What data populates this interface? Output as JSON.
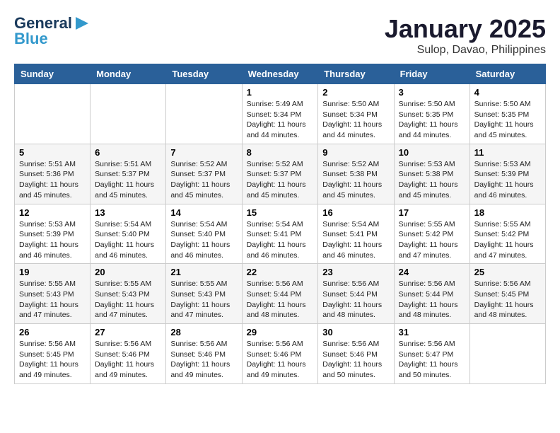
{
  "header": {
    "logo_general": "General",
    "logo_blue": "Blue",
    "month_title": "January 2025",
    "location": "Sulop, Davao, Philippines"
  },
  "weekdays": [
    "Sunday",
    "Monday",
    "Tuesday",
    "Wednesday",
    "Thursday",
    "Friday",
    "Saturday"
  ],
  "weeks": [
    [
      {
        "day": "",
        "sunrise": "",
        "sunset": "",
        "daylight": ""
      },
      {
        "day": "",
        "sunrise": "",
        "sunset": "",
        "daylight": ""
      },
      {
        "day": "",
        "sunrise": "",
        "sunset": "",
        "daylight": ""
      },
      {
        "day": "1",
        "sunrise": "Sunrise: 5:49 AM",
        "sunset": "Sunset: 5:34 PM",
        "daylight": "Daylight: 11 hours and 44 minutes."
      },
      {
        "day": "2",
        "sunrise": "Sunrise: 5:50 AM",
        "sunset": "Sunset: 5:34 PM",
        "daylight": "Daylight: 11 hours and 44 minutes."
      },
      {
        "day": "3",
        "sunrise": "Sunrise: 5:50 AM",
        "sunset": "Sunset: 5:35 PM",
        "daylight": "Daylight: 11 hours and 44 minutes."
      },
      {
        "day": "4",
        "sunrise": "Sunrise: 5:50 AM",
        "sunset": "Sunset: 5:35 PM",
        "daylight": "Daylight: 11 hours and 45 minutes."
      }
    ],
    [
      {
        "day": "5",
        "sunrise": "Sunrise: 5:51 AM",
        "sunset": "Sunset: 5:36 PM",
        "daylight": "Daylight: 11 hours and 45 minutes."
      },
      {
        "day": "6",
        "sunrise": "Sunrise: 5:51 AM",
        "sunset": "Sunset: 5:37 PM",
        "daylight": "Daylight: 11 hours and 45 minutes."
      },
      {
        "day": "7",
        "sunrise": "Sunrise: 5:52 AM",
        "sunset": "Sunset: 5:37 PM",
        "daylight": "Daylight: 11 hours and 45 minutes."
      },
      {
        "day": "8",
        "sunrise": "Sunrise: 5:52 AM",
        "sunset": "Sunset: 5:37 PM",
        "daylight": "Daylight: 11 hours and 45 minutes."
      },
      {
        "day": "9",
        "sunrise": "Sunrise: 5:52 AM",
        "sunset": "Sunset: 5:38 PM",
        "daylight": "Daylight: 11 hours and 45 minutes."
      },
      {
        "day": "10",
        "sunrise": "Sunrise: 5:53 AM",
        "sunset": "Sunset: 5:38 PM",
        "daylight": "Daylight: 11 hours and 45 minutes."
      },
      {
        "day": "11",
        "sunrise": "Sunrise: 5:53 AM",
        "sunset": "Sunset: 5:39 PM",
        "daylight": "Daylight: 11 hours and 46 minutes."
      }
    ],
    [
      {
        "day": "12",
        "sunrise": "Sunrise: 5:53 AM",
        "sunset": "Sunset: 5:39 PM",
        "daylight": "Daylight: 11 hours and 46 minutes."
      },
      {
        "day": "13",
        "sunrise": "Sunrise: 5:54 AM",
        "sunset": "Sunset: 5:40 PM",
        "daylight": "Daylight: 11 hours and 46 minutes."
      },
      {
        "day": "14",
        "sunrise": "Sunrise: 5:54 AM",
        "sunset": "Sunset: 5:40 PM",
        "daylight": "Daylight: 11 hours and 46 minutes."
      },
      {
        "day": "15",
        "sunrise": "Sunrise: 5:54 AM",
        "sunset": "Sunset: 5:41 PM",
        "daylight": "Daylight: 11 hours and 46 minutes."
      },
      {
        "day": "16",
        "sunrise": "Sunrise: 5:54 AM",
        "sunset": "Sunset: 5:41 PM",
        "daylight": "Daylight: 11 hours and 46 minutes."
      },
      {
        "day": "17",
        "sunrise": "Sunrise: 5:55 AM",
        "sunset": "Sunset: 5:42 PM",
        "daylight": "Daylight: 11 hours and 47 minutes."
      },
      {
        "day": "18",
        "sunrise": "Sunrise: 5:55 AM",
        "sunset": "Sunset: 5:42 PM",
        "daylight": "Daylight: 11 hours and 47 minutes."
      }
    ],
    [
      {
        "day": "19",
        "sunrise": "Sunrise: 5:55 AM",
        "sunset": "Sunset: 5:43 PM",
        "daylight": "Daylight: 11 hours and 47 minutes."
      },
      {
        "day": "20",
        "sunrise": "Sunrise: 5:55 AM",
        "sunset": "Sunset: 5:43 PM",
        "daylight": "Daylight: 11 hours and 47 minutes."
      },
      {
        "day": "21",
        "sunrise": "Sunrise: 5:55 AM",
        "sunset": "Sunset: 5:43 PM",
        "daylight": "Daylight: 11 hours and 47 minutes."
      },
      {
        "day": "22",
        "sunrise": "Sunrise: 5:56 AM",
        "sunset": "Sunset: 5:44 PM",
        "daylight": "Daylight: 11 hours and 48 minutes."
      },
      {
        "day": "23",
        "sunrise": "Sunrise: 5:56 AM",
        "sunset": "Sunset: 5:44 PM",
        "daylight": "Daylight: 11 hours and 48 minutes."
      },
      {
        "day": "24",
        "sunrise": "Sunrise: 5:56 AM",
        "sunset": "Sunset: 5:44 PM",
        "daylight": "Daylight: 11 hours and 48 minutes."
      },
      {
        "day": "25",
        "sunrise": "Sunrise: 5:56 AM",
        "sunset": "Sunset: 5:45 PM",
        "daylight": "Daylight: 11 hours and 48 minutes."
      }
    ],
    [
      {
        "day": "26",
        "sunrise": "Sunrise: 5:56 AM",
        "sunset": "Sunset: 5:45 PM",
        "daylight": "Daylight: 11 hours and 49 minutes."
      },
      {
        "day": "27",
        "sunrise": "Sunrise: 5:56 AM",
        "sunset": "Sunset: 5:46 PM",
        "daylight": "Daylight: 11 hours and 49 minutes."
      },
      {
        "day": "28",
        "sunrise": "Sunrise: 5:56 AM",
        "sunset": "Sunset: 5:46 PM",
        "daylight": "Daylight: 11 hours and 49 minutes."
      },
      {
        "day": "29",
        "sunrise": "Sunrise: 5:56 AM",
        "sunset": "Sunset: 5:46 PM",
        "daylight": "Daylight: 11 hours and 49 minutes."
      },
      {
        "day": "30",
        "sunrise": "Sunrise: 5:56 AM",
        "sunset": "Sunset: 5:46 PM",
        "daylight": "Daylight: 11 hours and 50 minutes."
      },
      {
        "day": "31",
        "sunrise": "Sunrise: 5:56 AM",
        "sunset": "Sunset: 5:47 PM",
        "daylight": "Daylight: 11 hours and 50 minutes."
      },
      {
        "day": "",
        "sunrise": "",
        "sunset": "",
        "daylight": ""
      }
    ]
  ]
}
